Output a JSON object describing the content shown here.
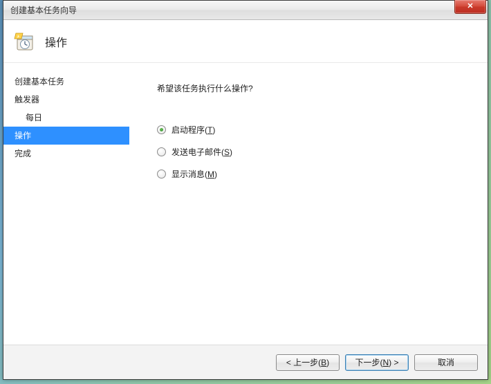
{
  "window": {
    "title": "创建基本任务向导"
  },
  "header": {
    "title": "操作"
  },
  "sidebar": {
    "items": [
      {
        "label": "创建基本任务",
        "selected": false,
        "sub": false
      },
      {
        "label": "触发器",
        "selected": false,
        "sub": false
      },
      {
        "label": "每日",
        "selected": false,
        "sub": true
      },
      {
        "label": "操作",
        "selected": true,
        "sub": false
      },
      {
        "label": "完成",
        "selected": false,
        "sub": false
      }
    ]
  },
  "main": {
    "question": "希望该任务执行什么操作?",
    "options": [
      {
        "label": "启动程序",
        "accel": "T",
        "checked": true
      },
      {
        "label": "发送电子邮件",
        "accel": "S",
        "checked": false
      },
      {
        "label": "显示消息",
        "accel": "M",
        "checked": false
      }
    ]
  },
  "footer": {
    "back": {
      "prefix": "< 上一步(",
      "accel": "B",
      "suffix": ")"
    },
    "next": {
      "prefix": "下一步(",
      "accel": "N",
      "suffix": ") >"
    },
    "cancel": "取消"
  }
}
